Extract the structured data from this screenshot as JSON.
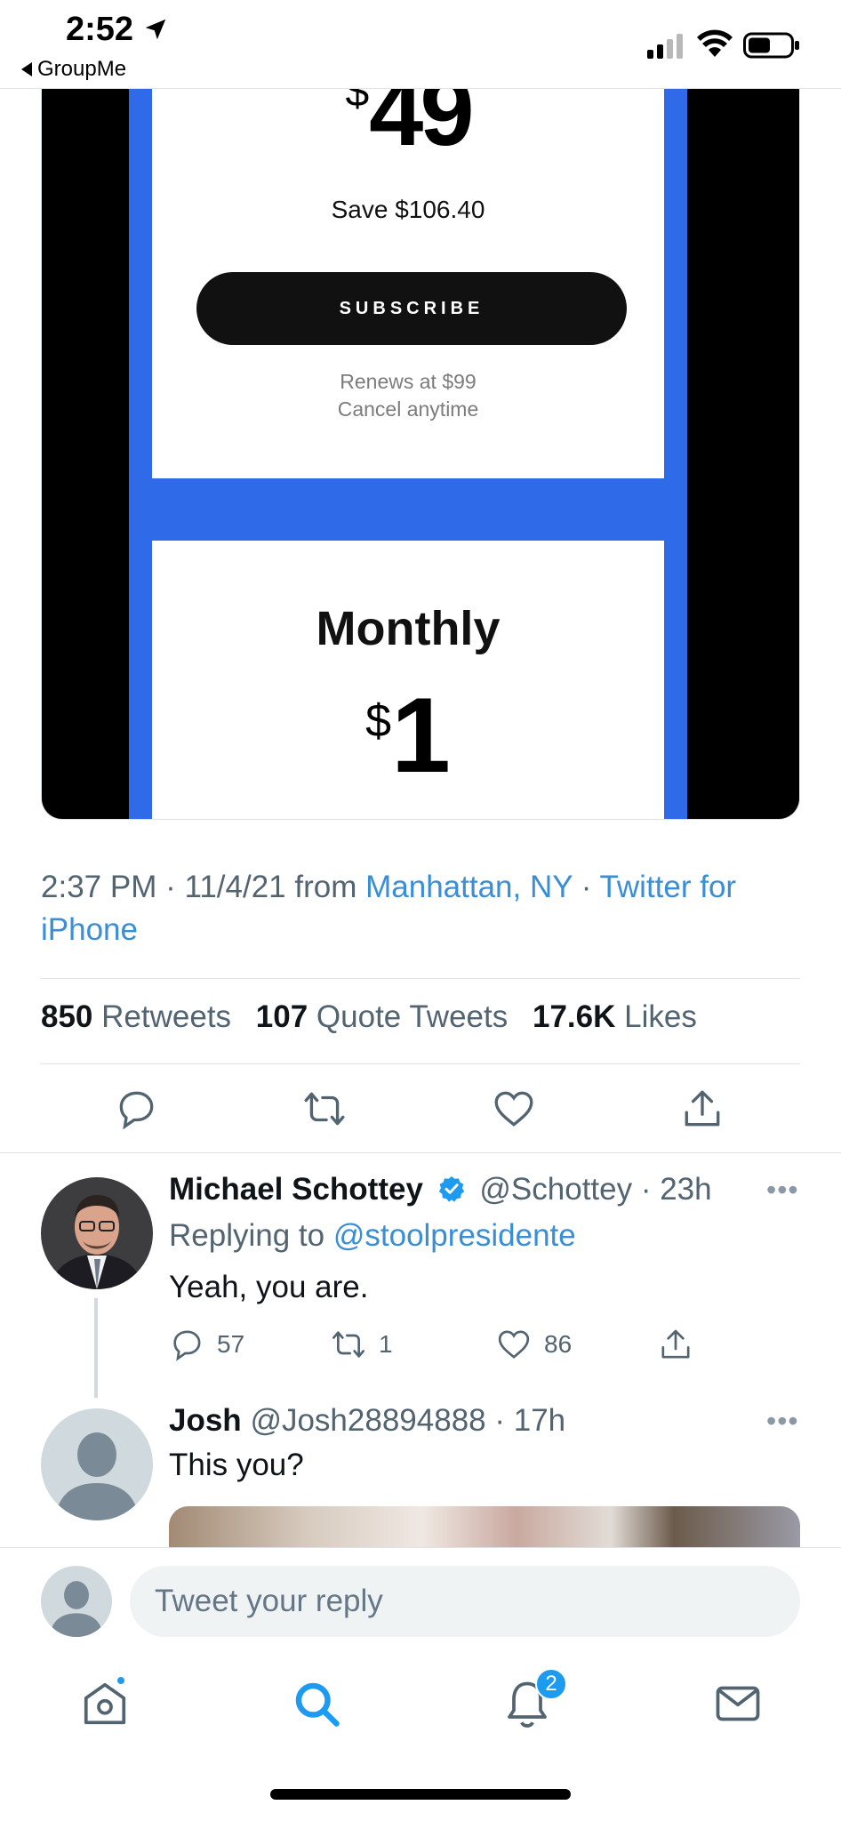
{
  "status_bar": {
    "time": "2:52",
    "back_app": "GroupMe"
  },
  "media": {
    "annual_price": "49",
    "currency": "$",
    "save_text": "Save $106.40",
    "subscribe_label": "SUBSCRIBE",
    "renews_text": "Renews at $99",
    "cancel_text": "Cancel anytime",
    "monthly_title": "Monthly",
    "monthly_price": "1"
  },
  "tweet": {
    "time": "2:37 PM",
    "date": "11/4/21",
    "from_label": "from",
    "location": "Manhattan, NY",
    "source": "Twitter for iPhone",
    "retweets_count": "850",
    "retweets_label": "Retweets",
    "quotes_count": "107",
    "quotes_label": "Quote Tweets",
    "likes_count": "17.6K",
    "likes_label": "Likes"
  },
  "replies": [
    {
      "name": "Michael Schottey",
      "handle": "@Schottey",
      "age": "23h",
      "replying_prefix": "Replying to",
      "replying_to": "@stoolpresidente",
      "text": "Yeah, you are.",
      "reply_count": "57",
      "retweet_count": "1",
      "like_count": "86",
      "verified": true
    },
    {
      "name": "Josh",
      "handle": "@Josh28894888",
      "age": "17h",
      "text": "This you?"
    }
  ],
  "compose": {
    "placeholder": "Tweet your reply"
  },
  "tabbar": {
    "notifications_badge": "2"
  },
  "colors": {
    "accent": "#1d9bf0",
    "link": "#3a8ed6",
    "panel_blue": "#2f6be8"
  }
}
